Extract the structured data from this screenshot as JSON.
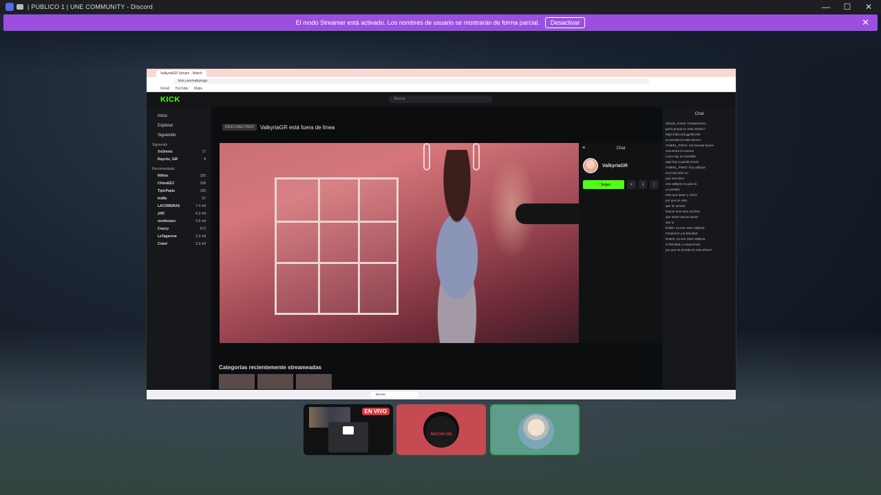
{
  "titlebar": {
    "title": "| PUBLICO 1 | UNE COMMUNITY - Discord"
  },
  "window_controls": {
    "minimize": "—",
    "maximize": "☐",
    "close": "✕"
  },
  "banner": {
    "message": "El modo Streamer está activado. Los nombres de usuario se mostrarán de forma parcial.",
    "button_label": "Desactivar",
    "close": "✕"
  },
  "shared_screen": {
    "browser_tab": "ValkyriaGR Stream - Watch",
    "url": "kick.com/valkyriagr",
    "bookmarks": [
      "Gmail",
      "YouTube",
      "Maps"
    ],
    "kick_logo": "KICK",
    "search_placeholder": "Buscar",
    "nav": [
      "Inicio",
      "Explorar",
      "Siguiendo"
    ],
    "following_section": "Siguiendo",
    "following": [
      {
        "name": "XxOmnis",
        "viewers": "17"
      },
      {
        "name": "Raychu_GM",
        "viewers": "8"
      }
    ],
    "recommended_section": "Recomendado",
    "recommended": [
      {
        "name": "Rifinix",
        "viewers": "105"
      },
      {
        "name": "ChinoEDJ",
        "viewers": "108"
      },
      {
        "name": "TipicPapio",
        "viewers": "106"
      },
      {
        "name": "Indifa",
        "viewers": "57"
      },
      {
        "name": "LACOMERAS",
        "viewers": "7.4 mil"
      },
      {
        "name": "yHD",
        "viewers": "6.3 mil"
      },
      {
        "name": "nexthestes",
        "viewers": "3.6 mil"
      },
      {
        "name": "Crazzy",
        "viewers": "673"
      },
      {
        "name": "LaTagarena",
        "viewers": "3.3 mil"
      },
      {
        "name": "Cobel",
        "viewers": "3.3 mil"
      }
    ],
    "offline_tag": "DESCONECTADO",
    "offline_title": "ValkyriaGR está fuera de línea",
    "chat_title": "Chat",
    "channel_name": "ValkyriaGR",
    "follow_label": "♡ Seguir",
    "share_icon": "<",
    "download_icon": "⤓",
    "more_icon": "⋮",
    "stream_chat_title": "Chat",
    "stream_chat_lines": [
      "Saludo_Suave: Fantasticame",
      "gorra propia en esta estado?",
      "https://discord.gg/3kinvite",
      "se prenda en esta ahora?",
      "YAMIEL_PNKO: me buenas bueno",
      "encuentra la camera",
      "como hay un estrellita",
      "aqui hay a partida fondo",
      "YAMIEL_PNKO: hoy valkyria",
      "sus hola bien no",
      "que sera bien",
      "una valkyria no para la",
      "yo pueden",
      "mas que quien y cierra",
      "por que es esta",
      "que la camara",
      "buscar tuvo mas muchas",
      "que asere parras sanas",
      "que tu",
      "Rotkin: ya ese Yami Valkyria",
      "Fandori24 y la felicidad",
      "RotKin: ya ese Yami Valkyria",
      "la felicidad y compromiso",
      "por que se prenda en esta ahora?"
    ],
    "recent_categories": "Categorías recientemente streameadas",
    "taskbar_search": "Buscar"
  },
  "participants": [
    {
      "id": "screen",
      "live_label": "EN VIVO"
    },
    {
      "id": "raychu",
      "avatar_text": "RAYCHU GM"
    },
    {
      "id": "naruto"
    }
  ],
  "colors": {
    "banner": "#9b4fe0",
    "kick_green": "#53fc18",
    "live_red": "#da373c",
    "tile_red": "#c54a52",
    "tile_teal": "#5f9c8c",
    "speaking_ring": "#3ba55d"
  }
}
